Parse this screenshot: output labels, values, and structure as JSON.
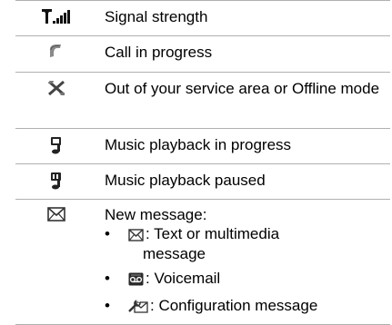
{
  "rows": [
    {
      "icon": "signal-strength-icon",
      "text": "Signal strength"
    },
    {
      "icon": "call-in-progress-icon",
      "text": "Call in progress"
    },
    {
      "icon": "out-of-service-icon",
      "text": "Out of your service area or Offline mode"
    },
    {
      "icon": "music-playing-icon",
      "text": "Music playback in progress"
    },
    {
      "icon": "music-paused-icon",
      "text": "Music playback paused"
    },
    {
      "icon": "new-message-icon",
      "text": "New message:",
      "sub_items": [
        {
          "bullet": "•",
          "icon": "envelope-icon",
          "text_line1": ": Text or multimedia",
          "text_line2": "message"
        },
        {
          "bullet": "•",
          "icon": "voicemail-icon",
          "text_line1": ": Voicemail"
        },
        {
          "bullet": "•",
          "icon": "configuration-message-icon",
          "text_line1": ": Configuration message"
        }
      ]
    }
  ]
}
